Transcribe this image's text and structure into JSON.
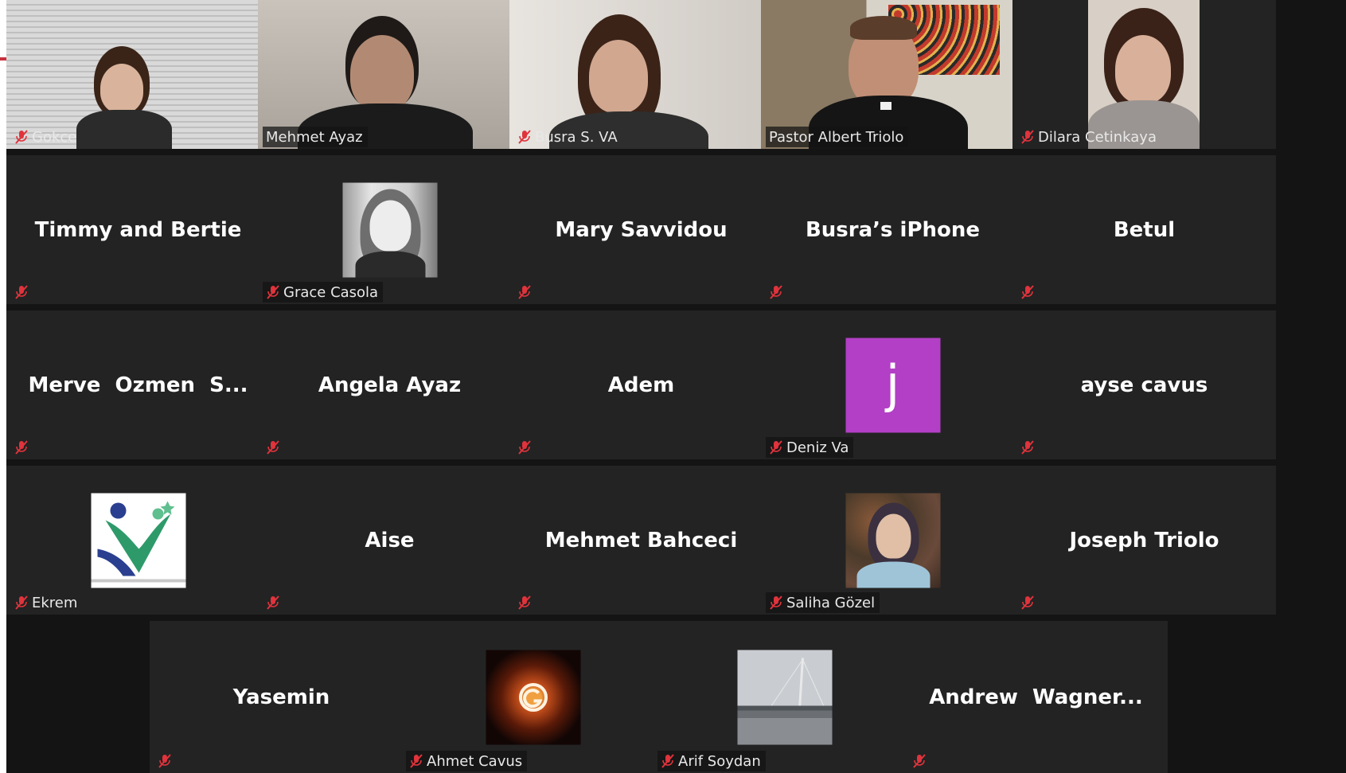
{
  "colors": {
    "tile_bg": "#232323",
    "stage_bg": "#141414",
    "active_speaker_border": "#c7e34a",
    "muted_icon": "#e0333c",
    "avatar_j_bg": "#b33fc6"
  },
  "participants": [
    {
      "name": "Gokce",
      "type": "video",
      "muted": true
    },
    {
      "name": "Mehmet Ayaz",
      "type": "video",
      "muted": false
    },
    {
      "name": "Busra  S. VA",
      "type": "video",
      "muted": true
    },
    {
      "name": "Pastor Albert Triolo",
      "type": "video",
      "muted": false,
      "active_speaker": true
    },
    {
      "name": "Dilara Cetinkaya",
      "type": "video",
      "muted": true
    },
    {
      "name": "Timmy and Bertie",
      "type": "name",
      "muted": true
    },
    {
      "name": "Grace Casola",
      "type": "photo",
      "muted": true,
      "photo": "portrait photo"
    },
    {
      "name": "Mary Savvidou",
      "type": "name",
      "muted": true
    },
    {
      "name": "Busra’s iPhone",
      "type": "name",
      "muted": true
    },
    {
      "name": "Betul",
      "type": "name",
      "muted": true
    },
    {
      "name": "Merve  Ozmen  S...",
      "type": "name",
      "muted": true
    },
    {
      "name": "Angela Ayaz",
      "type": "name",
      "muted": true
    },
    {
      "name": "Adem",
      "type": "name",
      "muted": true
    },
    {
      "name": "Deniz Va",
      "type": "letter",
      "muted": true,
      "letter": "j"
    },
    {
      "name": "ayse cavus",
      "type": "name",
      "muted": true
    },
    {
      "name": "Ekrem",
      "type": "photo",
      "muted": true,
      "photo": "logo"
    },
    {
      "name": "Aise",
      "type": "name",
      "muted": true
    },
    {
      "name": "Mehmet Bahceci",
      "type": "name",
      "muted": true
    },
    {
      "name": "Saliha Gözel",
      "type": "photo",
      "muted": true,
      "photo": "portrait photo"
    },
    {
      "name": "Joseph Triolo",
      "type": "name",
      "muted": true
    },
    {
      "name": "Yasemin",
      "type": "name",
      "muted": true
    },
    {
      "name": "Ahmet Cavus",
      "type": "photo",
      "muted": true,
      "photo": "team emblem"
    },
    {
      "name": "Arif Soydan",
      "type": "photo",
      "muted": true,
      "photo": "bridge landscape"
    },
    {
      "name": "Andrew  Wagner...",
      "type": "name",
      "muted": true
    }
  ]
}
